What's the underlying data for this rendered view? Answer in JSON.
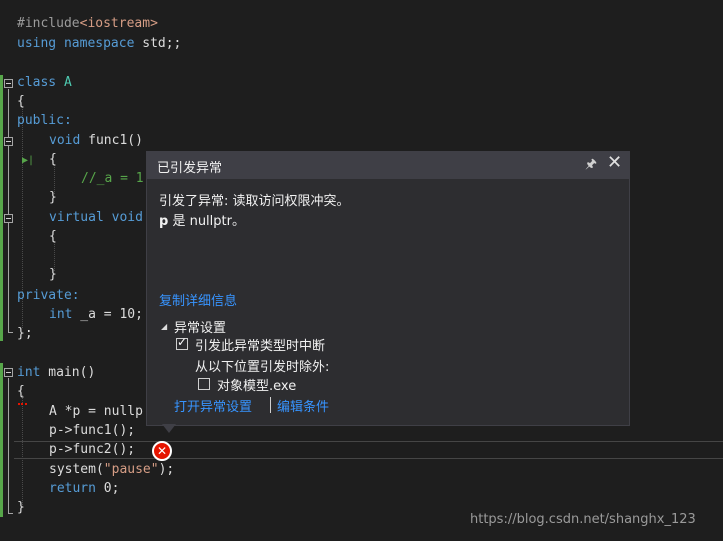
{
  "code": {
    "include_directive": "#include",
    "include_target": "<iostream>",
    "using_kw": "using",
    "namespace_kw": "namespace",
    "using_rest": " std;;",
    "class_kw": "class",
    "class_name": " A",
    "open_brace": "{",
    "close_brace": "}",
    "close_class": "};",
    "public_label": "public:",
    "void_kw": "void",
    "func1_decl": " func1()",
    "comment_line": "//_a = 1",
    "virtual_kw": "virtual",
    "void_kw2": " void",
    "private_label": "private:",
    "int_kw": "int",
    "member_decl": " _a = 10;",
    "main_int_kw": "int",
    "main_decl": " main()",
    "ptr_line": "A *p = nullp",
    "call1": "p->func1();",
    "call2": "p->func2();",
    "system_call_start": "system(",
    "system_call_arg": "\"pause\"",
    "system_call_end": ");",
    "return_kw": "return",
    "return_rest": " 0;"
  },
  "popup": {
    "title": "已引发异常",
    "message_line1": "引发了异常: 读取访问权限冲突。",
    "message_var": "p",
    "message_line2_rest": " 是 nullptr。",
    "copy_details": "复制详细信息",
    "section_title": "异常设置",
    "break_option": "引发此异常类型时中断",
    "break_checked": true,
    "except_label": "从以下位置引发时除外:",
    "object_model_option": "对象模型.exe",
    "object_model_checked": false,
    "open_settings_link": "打开异常设置",
    "edit_conditions_link": "编辑条件"
  },
  "watermark": "https://blog.csdn.net/shanghx_123",
  "colors": {
    "editor_bg": "#1e1e1e",
    "keyword": "#569cd6",
    "link": "#3794ff",
    "error": "#e51400"
  },
  "icons": [
    "pin-icon",
    "close-icon",
    "error-icon",
    "fold-icon",
    "execution-arrow-icon"
  ]
}
